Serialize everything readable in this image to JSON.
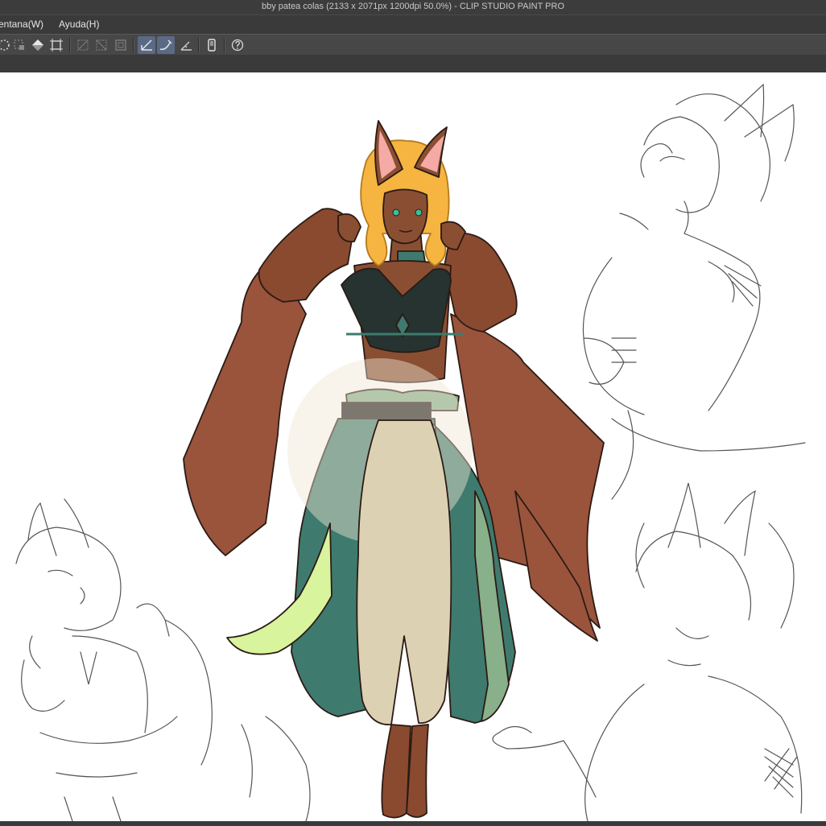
{
  "window": {
    "title": "bby patea colas (2133 x 2071px 1200dpi 50.0%)  - CLIP STUDIO PAINT PRO"
  },
  "menubar": {
    "items": [
      {
        "label": "entana(W)"
      },
      {
        "label": "Ayuda(H)"
      }
    ]
  },
  "toolbar": {
    "tools": [
      {
        "icon": "select-all-icon"
      },
      {
        "icon": "deselect-icon"
      },
      {
        "icon": "fill-bucket-icon"
      },
      {
        "icon": "transform-icon"
      },
      {
        "icon": "clear-outside-icon"
      },
      {
        "icon": "clear-selection-icon"
      },
      {
        "icon": "selection-frame-icon"
      },
      {
        "icon": "ruler-snap-icon",
        "active": true
      },
      {
        "icon": "special-ruler-snap-icon",
        "active": true
      },
      {
        "icon": "grid-snap-icon"
      },
      {
        "icon": "device-icon"
      },
      {
        "icon": "help-icon"
      }
    ]
  },
  "colors": {
    "chrome_dark": "#3a3a3a",
    "chrome_mid": "#474747",
    "active_tool": "#5a6a86",
    "cape": "#9a543c",
    "skin": "#8a4f32",
    "hair": "#f6b441",
    "top": "#263330",
    "skirt_teal": "#3f7a6e",
    "skirt_trim": "#88b08a",
    "sash_lime": "#d8f49c",
    "pants": "#ddd1b4",
    "boots": "#8a4a30",
    "sketch_line": "#555555"
  }
}
